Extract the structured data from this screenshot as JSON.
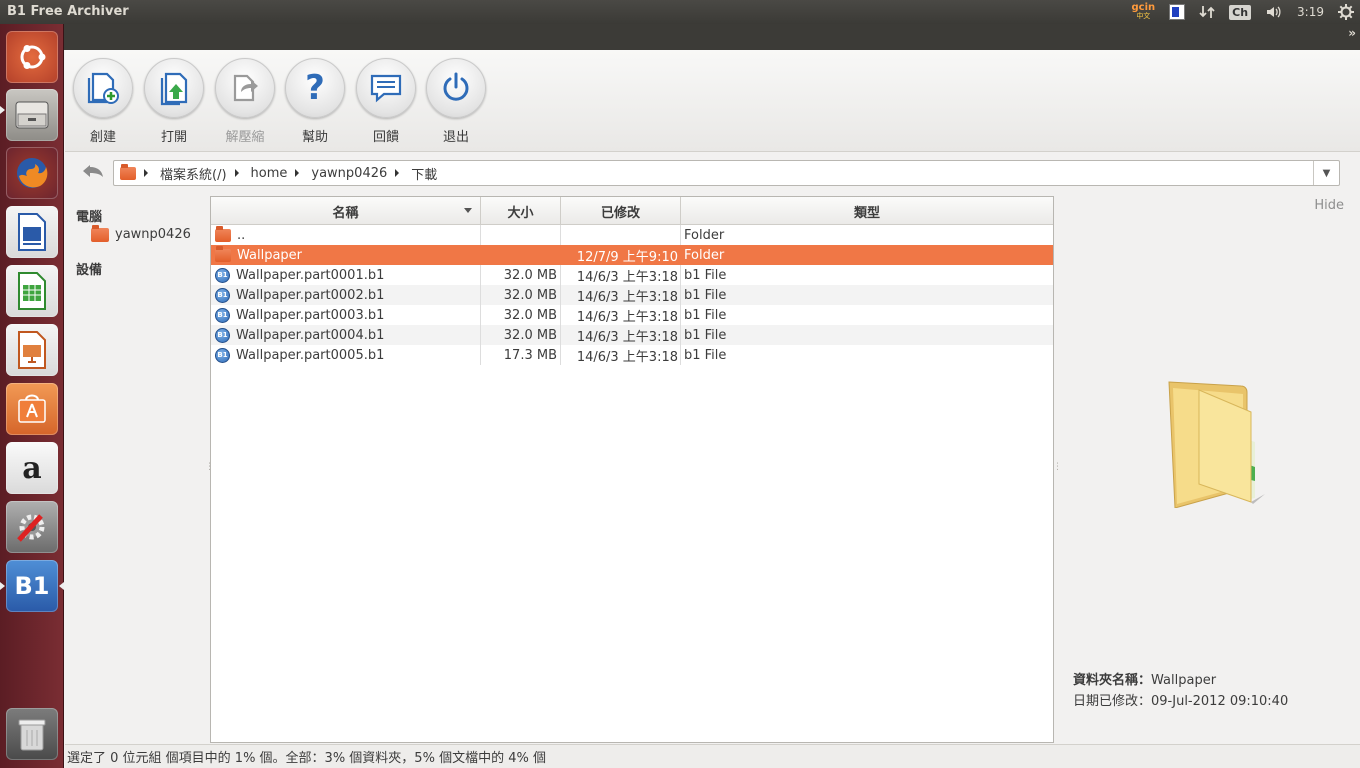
{
  "topbar": {
    "app_title": "B1 Free Archiver",
    "gcin_label": "gcin",
    "gcin_sub": "中文",
    "ch_label": "Ch",
    "clock": "3:19"
  },
  "toolbar": {
    "buttons": [
      {
        "label": "創建",
        "icon": "create-archive-icon"
      },
      {
        "label": "打開",
        "icon": "open-archive-icon"
      },
      {
        "label": "解壓縮",
        "icon": "extract-icon"
      },
      {
        "label": "幫助",
        "icon": "help-icon"
      },
      {
        "label": "回饋",
        "icon": "feedback-icon"
      },
      {
        "label": "退出",
        "icon": "power-icon"
      }
    ]
  },
  "address": {
    "crumbs": [
      "檔案系統(/)",
      "home",
      "yawnp0426",
      "下載"
    ]
  },
  "sidebar": {
    "computer_heading": "電腦",
    "home_item": "yawnp0426",
    "devices_heading": "設備"
  },
  "table": {
    "columns": [
      "名稱",
      "大小",
      "已修改",
      "類型"
    ],
    "rows": [
      {
        "name": "..",
        "size": "",
        "modified": "",
        "type": "Folder",
        "icon": "folder-icon"
      },
      {
        "name": "Wallpaper",
        "size": "",
        "modified": "12/7/9 上午9:10",
        "type": "Folder",
        "icon": "folder-icon"
      },
      {
        "name": "Wallpaper.part0001.b1",
        "size": "32.0 MB",
        "modified": "14/6/3 上午3:18",
        "type": "b1 File",
        "icon": "b1-file-icon"
      },
      {
        "name": "Wallpaper.part0002.b1",
        "size": "32.0 MB",
        "modified": "14/6/3 上午3:18",
        "type": "b1 File",
        "icon": "b1-file-icon"
      },
      {
        "name": "Wallpaper.part0003.b1",
        "size": "32.0 MB",
        "modified": "14/6/3 上午3:18",
        "type": "b1 File",
        "icon": "b1-file-icon"
      },
      {
        "name": "Wallpaper.part0004.b1",
        "size": "32.0 MB",
        "modified": "14/6/3 上午3:18",
        "type": "b1 File",
        "icon": "b1-file-icon"
      },
      {
        "name": "Wallpaper.part0005.b1",
        "size": "17.3 MB",
        "modified": "14/6/3 上午3:18",
        "type": "b1 File",
        "icon": "b1-file-icon"
      }
    ]
  },
  "preview": {
    "hide_label": "Hide",
    "folder_name_label": "資料夾名稱：",
    "folder_name_value": "Wallpaper",
    "modified_label": "日期已修改：",
    "modified_value": "09-Jul-2012 09:10:40"
  },
  "status": {
    "text": "選定了 0 位元組 個項目中的 1% 個。全部：3% 個資料夾，5% 個文檔中的 4% 個"
  },
  "launcher": {
    "b1_label": "B1",
    "amazon_label": "a"
  },
  "colors": {
    "selection": "#f07746",
    "launcher": "#6a2430",
    "accent_blue": "#2f6cb8"
  }
}
